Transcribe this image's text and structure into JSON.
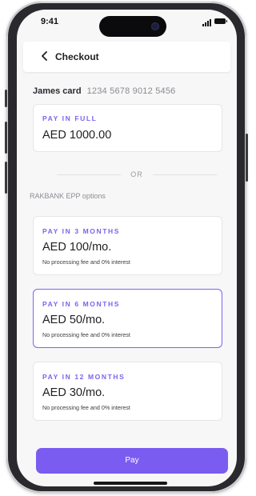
{
  "status_bar": {
    "time": "9:41"
  },
  "header": {
    "title": "Checkout"
  },
  "card": {
    "name": "James card",
    "number": "1234 5678 9012 5456"
  },
  "pay_full": {
    "label": "PAY IN FULL",
    "amount": "AED 1000.00"
  },
  "divider": {
    "text": "OR"
  },
  "epp": {
    "title": "RAKBANK EPP options",
    "options": [
      {
        "label": "PAY IN 3 MONTHS",
        "amount": "AED 100/mo.",
        "note": "No processing fee and 0% interest",
        "selected": false
      },
      {
        "label": "PAY IN 6 MONTHS",
        "amount": "AED 50/mo.",
        "note": "No processing fee and 0% interest",
        "selected": true
      },
      {
        "label": "PAY IN 12 MONTHS",
        "amount": "AED 30/mo.",
        "note": "No processing fee and 0% interest",
        "selected": false
      }
    ]
  },
  "pay_button": {
    "label": "Pay"
  },
  "colors": {
    "accent": "#7a5cf0",
    "background": "#f7f7f8"
  },
  "icons": {
    "back": "chevron-left-icon"
  }
}
